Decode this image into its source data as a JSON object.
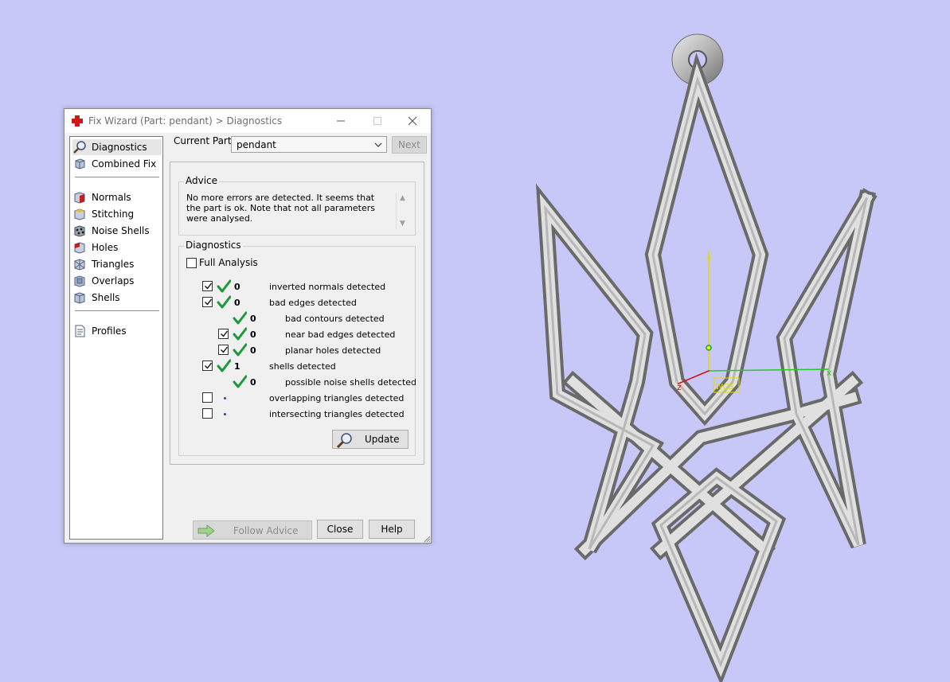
{
  "window": {
    "title": "Fix Wizard (Part: pendant) > Diagnostics"
  },
  "nav": {
    "items": [
      {
        "label": "Diagnostics",
        "icon": "magnifier-icon",
        "selected": true
      },
      {
        "label": "Combined Fix",
        "icon": "combined-fix-icon"
      },
      {
        "label": "Normals",
        "icon": "normals-icon"
      },
      {
        "label": "Stitching",
        "icon": "stitching-icon"
      },
      {
        "label": "Noise Shells",
        "icon": "noise-shells-icon"
      },
      {
        "label": "Holes",
        "icon": "holes-icon"
      },
      {
        "label": "Triangles",
        "icon": "triangles-icon"
      },
      {
        "label": "Overlaps",
        "icon": "overlaps-icon"
      },
      {
        "label": "Shells",
        "icon": "shells-icon"
      },
      {
        "label": "Profiles",
        "icon": "profiles-icon"
      }
    ]
  },
  "main": {
    "current_part_label": "Current Part:",
    "current_part_value": "pendant",
    "next_label": "Next",
    "advice_label": "Advice",
    "advice_text": "No more errors are detected. It seems that the part is ok. Note that not all parameters were analysed.",
    "diagnostics_label": "Diagnostics",
    "full_analysis_label": "Full Analysis",
    "rows": [
      {
        "checked": true,
        "status": "ok",
        "count": "0",
        "text": "inverted normals detected",
        "indent": 0
      },
      {
        "checked": true,
        "status": "ok",
        "count": "0",
        "text": "bad edges detected",
        "indent": 0
      },
      {
        "checked": null,
        "status": "ok",
        "count": "0",
        "text": "bad contours detected",
        "indent": 1
      },
      {
        "checked": true,
        "status": "ok",
        "count": "0",
        "text": "near bad edges detected",
        "indent": 1
      },
      {
        "checked": true,
        "status": "ok",
        "count": "0",
        "text": "planar holes detected",
        "indent": 1
      },
      {
        "checked": true,
        "status": "ok",
        "count": "1",
        "text": "shells detected",
        "indent": 0
      },
      {
        "checked": null,
        "status": "ok",
        "count": "0",
        "text": "possible noise shells detected",
        "indent": 1
      },
      {
        "checked": false,
        "status": "pending",
        "count": "",
        "text": "overlapping triangles detected",
        "indent": 0
      },
      {
        "checked": false,
        "status": "pending",
        "count": "",
        "text": "intersecting triangles detected",
        "indent": 0
      }
    ],
    "update_label": "Update"
  },
  "footer": {
    "follow_advice_label": "Follow Advice",
    "close_label": "Close",
    "help_label": "Help"
  },
  "viewport": {
    "axis_x_label": "x",
    "axis_y_label": "y",
    "axis_z_label": "z",
    "wcs_label": "WCS",
    "background": "#c8c8f8"
  }
}
